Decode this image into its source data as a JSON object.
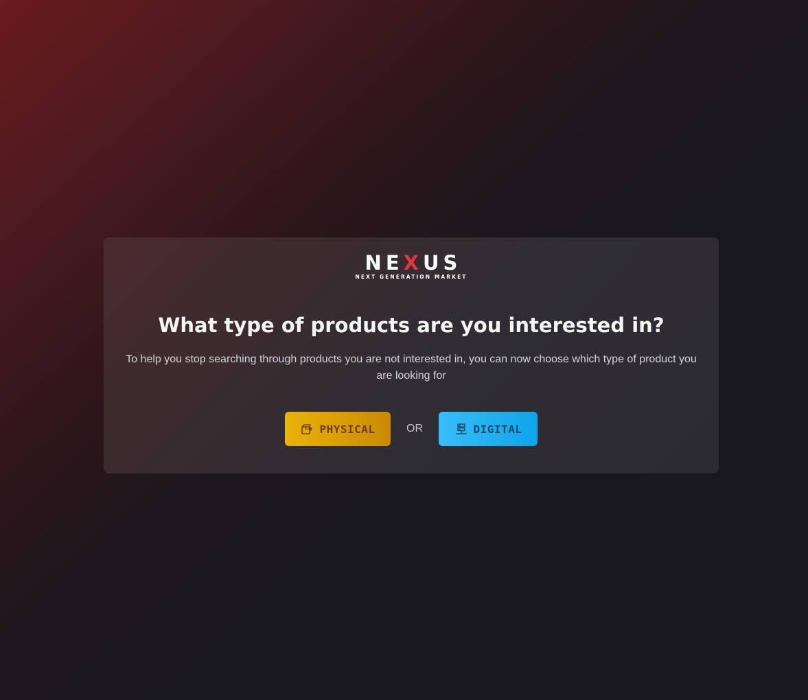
{
  "logo": {
    "word_part1": "NE",
    "word_x": "X",
    "word_part2": "US",
    "tagline": "NEXT GENERATION MARKET",
    "accent_color": "#e3363c"
  },
  "prompt": {
    "title": "What type of products are you interested in?",
    "description": "To help you stop searching through products you are not interested in, you can now choose which type of product you are looking for"
  },
  "choices": {
    "physical": {
      "label": "PHYSICAL",
      "icon": "package-icon",
      "color": "#eab308"
    },
    "separator": "OR",
    "digital": {
      "label": "DIGITAL",
      "icon": "server-icon",
      "color": "#38bdf8"
    }
  }
}
